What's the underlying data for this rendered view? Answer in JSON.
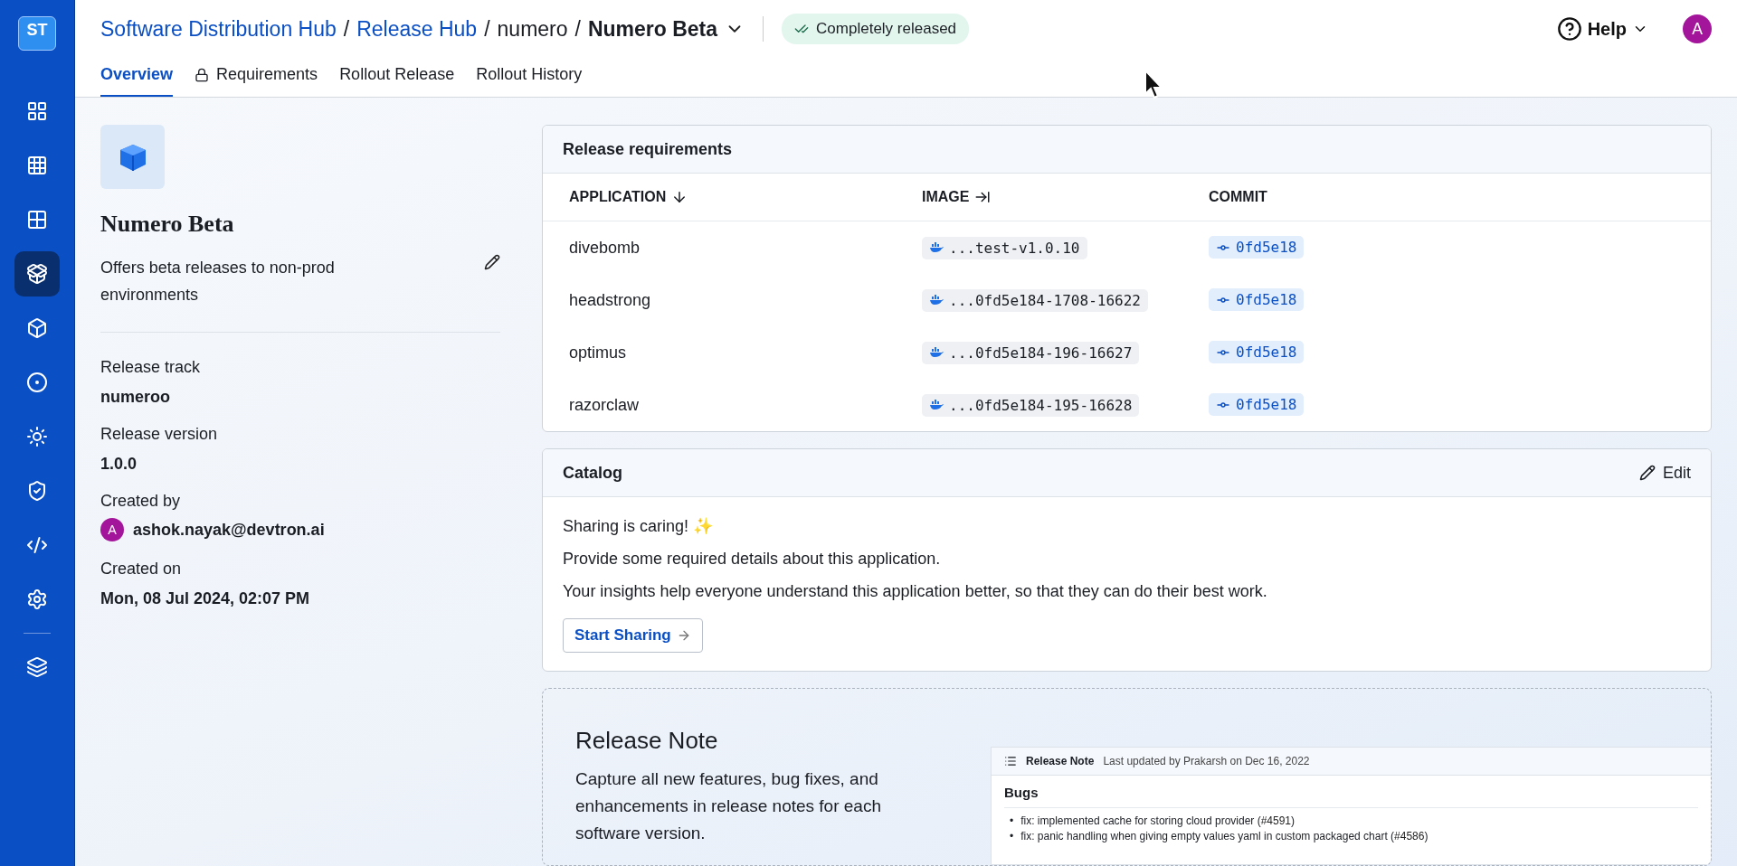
{
  "sidebar": {
    "logo": "ST",
    "groups": [
      [
        {
          "selected": false
        },
        {
          "selected": false
        },
        {
          "selected": false
        },
        {
          "selected": true
        },
        {
          "selected": false
        },
        {
          "selected": false
        },
        {
          "selected": false
        },
        {
          "selected": false
        },
        {
          "selected": false
        },
        {
          "selected": false
        }
      ],
      [
        {
          "selected": false
        }
      ]
    ]
  },
  "header": {
    "breadcrumbs": [
      {
        "label": "Software Distribution Hub",
        "kind": "link"
      },
      {
        "label": "Release Hub",
        "kind": "link"
      },
      {
        "label": "numero",
        "kind": "plain"
      },
      {
        "label": "Numero Beta",
        "kind": "current"
      }
    ],
    "separator": "/",
    "status": "Completely released",
    "help": "Help",
    "avatar": "A"
  },
  "tabs": [
    {
      "label": "Overview",
      "selected": true,
      "locked": false
    },
    {
      "label": "Requirements",
      "selected": false,
      "locked": true
    },
    {
      "label": "Rollout Release",
      "selected": false,
      "locked": false
    },
    {
      "label": "Rollout History",
      "selected": false,
      "locked": false
    }
  ],
  "details": {
    "title": "Numero Beta",
    "description": "Offers beta releases to non-prod environments",
    "fields": [
      {
        "label": "Release track",
        "value": "numeroo",
        "kind": "text"
      },
      {
        "label": "Release version",
        "value": "1.0.0",
        "kind": "text"
      },
      {
        "label": "Created by",
        "value": "ashok.nayak@devtron.ai",
        "kind": "user",
        "avatar": "A"
      },
      {
        "label": "Created on",
        "value": "Mon, 08 Jul 2024, 02:07 PM",
        "kind": "text"
      }
    ]
  },
  "requirements": {
    "title": "Release requirements",
    "columns": [
      {
        "label": "APPLICATION",
        "kind": "sortable"
      },
      {
        "label": "IMAGE",
        "kind": "expandable"
      },
      {
        "label": "COMMIT",
        "kind": "plain"
      }
    ],
    "rows": [
      {
        "application": "divebomb",
        "image": "...test-v1.0.10",
        "commit": "0fd5e18"
      },
      {
        "application": "headstrong",
        "image": "...0fd5e184-1708-16622",
        "commit": "0fd5e18"
      },
      {
        "application": "optimus",
        "image": "...0fd5e184-196-16627",
        "commit": "0fd5e18"
      },
      {
        "application": "razorclaw",
        "image": "...0fd5e184-195-16628",
        "commit": "0fd5e18"
      }
    ]
  },
  "catalog": {
    "title": "Catalog",
    "edit": "Edit",
    "lines": [
      "Sharing is caring! ✨",
      "Provide some required details about this application.",
      "Your insights help everyone understand this application better, so that they can do their best work."
    ],
    "button": "Start Sharing"
  },
  "release_note": {
    "title": "Release Note",
    "description": "Capture all new features, bug fixes, and enhancements in release notes for each software version.",
    "preview": {
      "title": "Release Note",
      "updated": "Last updated by Prakarsh on Dec 16, 2022",
      "section": "Bugs",
      "bullets": [
        {
          "marker": "•",
          "text": "fix: implemented cache for storing cloud provider (",
          "link": "#4591",
          "after": ")"
        },
        {
          "marker": "•",
          "text": "fix: panic handling when giving empty values yaml in custom packaged chart (",
          "link": "#4586",
          "after": ")"
        }
      ]
    }
  }
}
